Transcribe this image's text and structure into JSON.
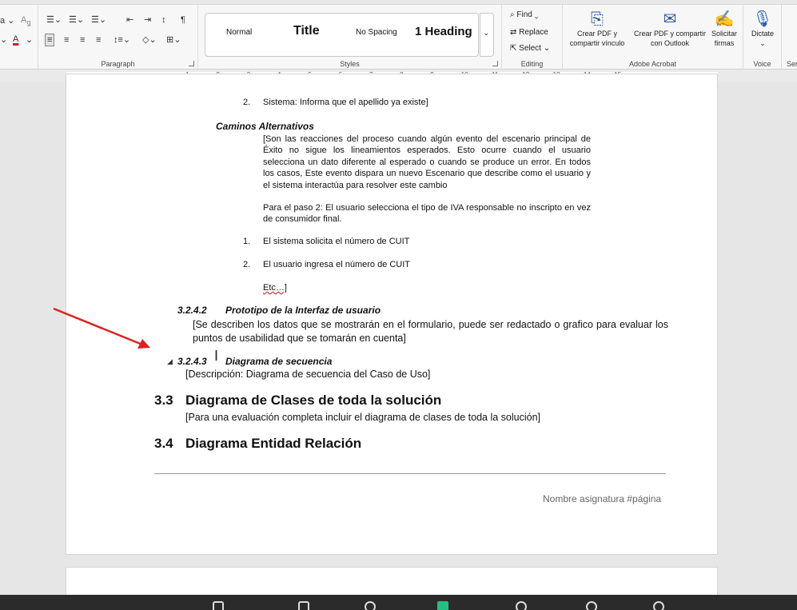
{
  "ribbon": {
    "groups": {
      "paragraph": "Paragraph",
      "styles": "Styles",
      "editing": "Editing",
      "adobe": "Adobe Acrobat",
      "voice": "Voice",
      "sensitivity_partial": "Ser"
    },
    "font_partial": "a",
    "styles_gallery": [
      {
        "label": "Normal"
      },
      {
        "label": "Title"
      },
      {
        "label": "No Spacing"
      },
      {
        "label": "1  Heading"
      }
    ],
    "editing": {
      "find": "Find",
      "replace": "Replace",
      "select": "Select"
    },
    "adobe": {
      "crear_pdf": [
        "Crear PDF y",
        "compartir vínculo"
      ],
      "crear_pdf_outlook": [
        "Crear PDF y compartir",
        "con Outlook"
      ],
      "solicitar": [
        "Solicitar",
        "firmas"
      ]
    },
    "voice": {
      "dictate": "Dictate"
    },
    "accent_color": "#1f5fbf",
    "adobe_color": "#2b579a"
  },
  "ruler": {
    "numbers": [
      "1",
      "2",
      "3",
      "4",
      "5",
      "6",
      "7",
      "8",
      "9",
      "10",
      "11",
      "12",
      "13",
      "14",
      "15"
    ]
  },
  "document": {
    "list_item_2_num": "2.",
    "list_item_2_text": "Sistema: Informa que el apellido ya existe]",
    "caminos_heading": "Caminos Alternativos",
    "caminos_para": "[Son las reacciones del proceso cuando algún evento del escenario principal de Éxito no sigue los lineamientos esperados. Esto ocurre cuando el usuario selecciona un dato diferente al esperado o cuando se produce un error. En todos los casos, Este evento dispara un nuevo Escenario que describe como el usuario y el sistema interactúa para resolver este cambio",
    "paso2_para": "Para el paso 2: El usuario selecciona el tipo de IVA responsable no inscripto en vez de consumidor final.",
    "alt_list": [
      {
        "num": "1.",
        "text": "El sistema solicita el número de CUIT"
      },
      {
        "num": "2.",
        "text": "El usuario ingresa el número de CUIT"
      }
    ],
    "etc": "Etc…]",
    "h3242_num": "3.2.4.2",
    "h3242_title": "Prototipo de la Interfaz de usuario",
    "h3242_body": "[Se describen los datos que se mostrarán en el formulario, puede ser redactado o grafico para evaluar los puntos de usabilidad que se tomarán en cuenta]",
    "h3243_num": "3.2.4.3",
    "h3243_title": "Diagrama de secuencia",
    "h3243_body": "[Descripción: Diagrama de secuencia del Caso de Uso]",
    "h33_num": "3.3",
    "h33_title": "Diagrama de Clases de toda la solución",
    "h33_body": "[Para una evaluación completa incluir el diagrama de clases de toda la solución]",
    "h34_num": "3.4",
    "h34_title": "Diagrama Entidad Relación",
    "footer": "Nombre asignatura #página"
  },
  "annotation": {
    "arrow_color": "#e02020"
  }
}
